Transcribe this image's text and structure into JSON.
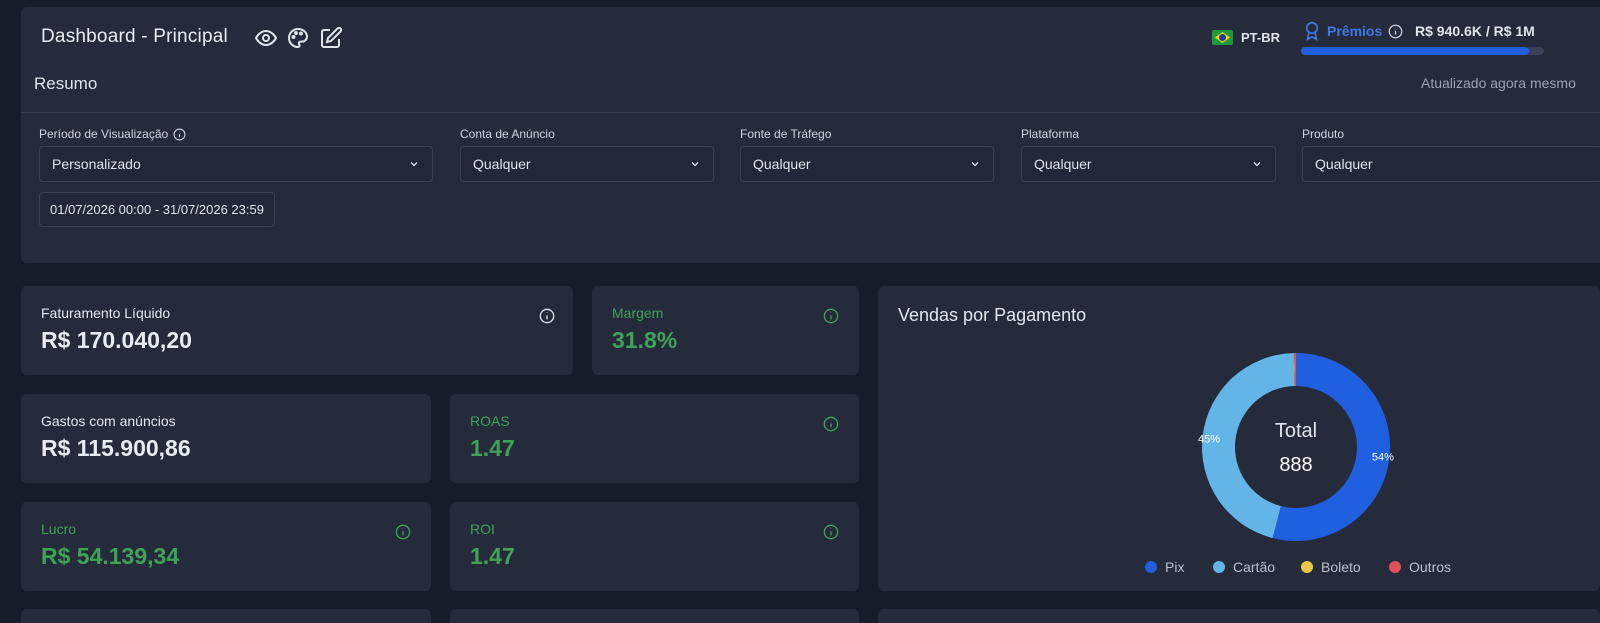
{
  "header": {
    "title": "Dashboard - Principal",
    "language": "PT-BR",
    "rewards_label": "Prêmios",
    "rewards_value": "R$ 940.6K  /  R$ 1M",
    "rewards_progress": 0.94
  },
  "summary": {
    "title": "Resumo",
    "updated": "Atualizado agora mesmo",
    "filters": [
      {
        "label": "Período de Visualização",
        "value": "Personalizado"
      },
      {
        "label": "Conta de Anúncio",
        "value": "Qualquer"
      },
      {
        "label": "Fonte de Tráfego",
        "value": "Qualquer"
      },
      {
        "label": "Plataforma",
        "value": "Qualquer"
      },
      {
        "label": "Produto",
        "value": "Qualquer"
      }
    ],
    "date_range": "01/07/2026 00:00 - 31/07/2026 23:59"
  },
  "metrics": {
    "revenue": {
      "label": "Faturamento Líquido",
      "value": "R$ 170.040,20"
    },
    "margin": {
      "label": "Margem",
      "value": "31.8%"
    },
    "ad_spend": {
      "label": "Gastos com anúncios",
      "value": "R$ 115.900,86"
    },
    "roas": {
      "label": "ROAS",
      "value": "1.47"
    },
    "profit": {
      "label": "Lucro",
      "value": "R$ 54.139,34"
    },
    "roi": {
      "label": "ROI",
      "value": "1.47"
    }
  },
  "payments": {
    "title": "Vendas por Pagamento",
    "center_label": "Total",
    "center_value": "888",
    "slices": [
      {
        "name": "Pix",
        "percent": 54,
        "label": "54%",
        "color": "#1f5fe0"
      },
      {
        "name": "Cartão",
        "percent": 45.6,
        "label": "45%",
        "color": "#63b5e8"
      },
      {
        "name": "Boleto",
        "percent": 0.1,
        "label": "",
        "color": "#e9c54a"
      },
      {
        "name": "Outros",
        "percent": 0.3,
        "label": "",
        "color": "#e0505a"
      }
    ]
  },
  "colors": {
    "accent": "#1f5fe0",
    "positive": "#3fa356",
    "panel": "#252b3b",
    "background": "#171c2b"
  },
  "icons": [
    "eye-icon",
    "palette-icon",
    "edit-icon",
    "info-icon",
    "award-icon",
    "chevron-down-icon",
    "brazil-flag-icon"
  ]
}
